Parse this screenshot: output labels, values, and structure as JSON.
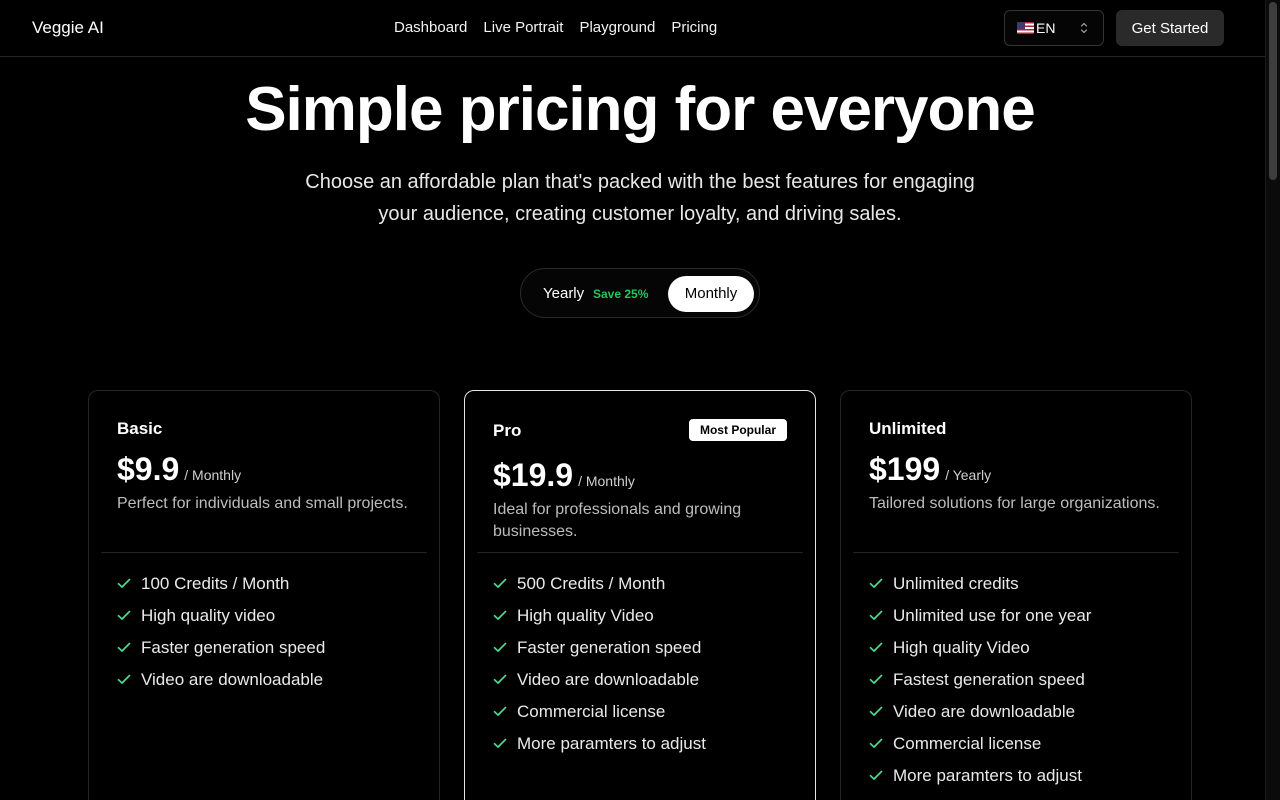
{
  "header": {
    "brand": "Veggie AI",
    "nav": [
      "Dashboard",
      "Live Portrait",
      "Playground",
      "Pricing"
    ],
    "language": "EN",
    "cta": "Get Started"
  },
  "hero": {
    "title": "Simple pricing for everyone",
    "subtitle": "Choose an affordable plan that's packed with the best features for engaging your audience, creating customer loyalty, and driving sales."
  },
  "billing_toggle": {
    "yearly": "Yearly",
    "save": "Save 25%",
    "monthly": "Monthly",
    "selected": "Monthly"
  },
  "plans": [
    {
      "name": "Basic",
      "price": "$9.9",
      "period": "/ Monthly",
      "description": "Perfect for individuals and small projects.",
      "features": [
        "100 Credits / Month",
        "High quality video",
        "Faster generation speed",
        "Video are downloadable"
      ]
    },
    {
      "name": "Pro",
      "badge": "Most Popular",
      "price": "$19.9",
      "period": "/ Monthly",
      "description": "Ideal for professionals and growing businesses.",
      "features": [
        "500 Credits / Month",
        "High quality Video",
        "Faster generation speed",
        "Video are downloadable",
        "Commercial license",
        "More paramters to adjust"
      ]
    },
    {
      "name": "Unlimited",
      "price": "$199",
      "period": "/ Yearly",
      "description": "Tailored solutions for large organizations.",
      "features": [
        "Unlimited credits",
        "Unlimited use for one year",
        "High quality Video",
        "Fastest generation speed",
        "Video are downloadable",
        "Commercial license",
        "More paramters to adjust"
      ]
    }
  ],
  "colors": {
    "background": "#000000",
    "accent_green": "#22c55e",
    "check_green": "#4ade80",
    "button_dark": "#2a2a2a"
  },
  "icons": [
    "us-flag-icon",
    "chevron-up-down-icon",
    "check-icon"
  ]
}
